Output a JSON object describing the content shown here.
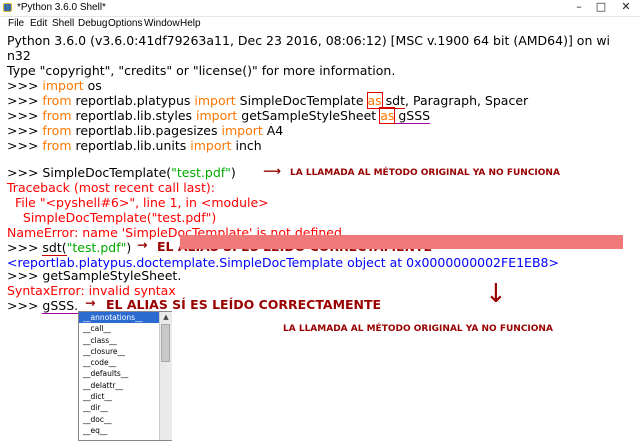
{
  "window": {
    "title": "*Python 3.6.0 Shell*",
    "minimize": "–",
    "maximize": "□",
    "close": "✕"
  },
  "menu": [
    "File",
    "Edit",
    "Shell",
    "Debug",
    "Options",
    "Window",
    "Help"
  ],
  "shell": {
    "banner_1": "Python 3.6.0 (v3.6.0:41df79263a11, Dec 23 2016, 08:06:12) [MSC v.1900 64 bit (AMD64)] on wi",
    "banner_2": "n32",
    "banner_3": "Type \"copyright\", \"credits\" or \"license()\" for more information.",
    "prompt": ">>> ",
    "kw_import": "import",
    "kw_from": "from",
    "kw_as": "as",
    "mod_os": " os",
    "mod_platypus": " reportlab.platypus ",
    "names_platypus_1": " SimpleDocTemplate ",
    "alias_sdt": " sdt",
    "names_platypus_2": ", Paragraph, Spacer",
    "mod_styles": " reportlab.lib.styles ",
    "name_getsample": " getSampleStyleSheet ",
    "alias_gsss": " gSSS",
    "mod_pagesizes": " reportlab.lib.pagesizes ",
    "name_a4": " A4",
    "mod_units": " reportlab.lib.units ",
    "name_inch": " inch",
    "call_sdt_full": "SimpleDocTemplate(",
    "str_test": "\"test.pdf\"",
    "close_paren": ")",
    "tb_1": "Traceback (most recent call last):",
    "tb_2": "  File \"<pyshell#6>\", line 1, in <module>",
    "tb_3": "    SimpleDocTemplate(\"test.pdf\")",
    "tb_4": "NameError: name 'SimpleDocTemplate' is not defined",
    "call_sdt_alias": "sdt(",
    "result_obj": "<reportlab.platypus.doctemplate.SimpleDocTemplate object at 0x0000000002FE1EB8>",
    "call_getsample": "getSampleStyleSheet.",
    "syntax_err": "SyntaxError: invalid syntax",
    "typing_gsss": "gSSS."
  },
  "annotations": {
    "orig_fails_1": "LA LLAMADA AL MÉTODO ORIGINAL YA NO FUNCIONA",
    "alias_ok_1": "EL ALIAS SÍ ES LEÍDO CORRECTAMENTE",
    "alias_ok_2": "EL ALIAS SÍ ES LEÍDO CORRECTAMENTE",
    "orig_fails_2": "LA LLAMADA AL MÉTODO ORIGINAL YA NO FUNCIONA",
    "arrow_right": "⟶",
    "arrow_right_short": "→",
    "arrow_down": "↓"
  },
  "autocomplete": {
    "items": [
      "__annotations__",
      "__call__",
      "__class__",
      "__closure__",
      "__code__",
      "__defaults__",
      "__delattr__",
      "__dict__",
      "__dir__",
      "__doc__",
      "__eq__"
    ],
    "selected_index": 0,
    "scroll_up": "▲"
  },
  "colors": {
    "keyword": "#ff7700",
    "string": "#00aa00",
    "error": "#ff0000",
    "output": "#0000ff",
    "annotation": "#990000",
    "selection": "#2b6bd1"
  }
}
